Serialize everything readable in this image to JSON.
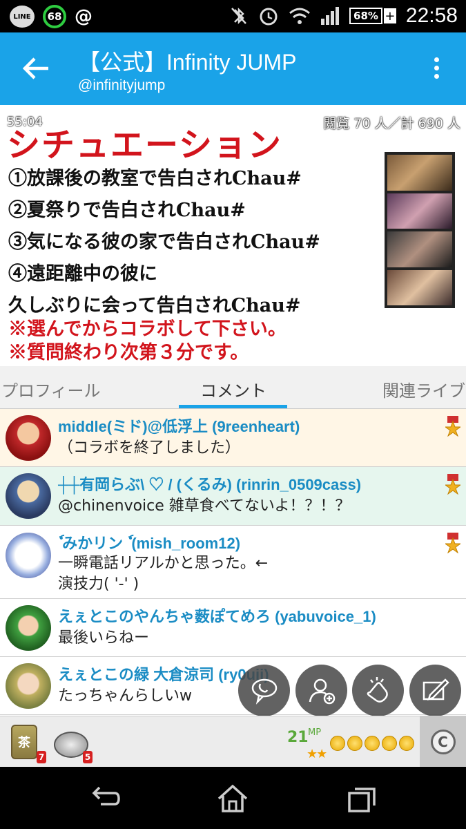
{
  "status_bar": {
    "line_label": "LINE",
    "notification_count": "68",
    "at_symbol": "@",
    "battery": "68%",
    "time": "22:58",
    "icons": [
      "bluetooth-off-icon",
      "alarm-icon",
      "wifi-icon",
      "signal-icon",
      "battery-icon"
    ]
  },
  "app_bar": {
    "title": "【公式】Infinity JUMP",
    "subtitle": "@infinityjump"
  },
  "broadcast": {
    "elapsed": "55:04",
    "viewers": "閲覧 70 人／計 690 人",
    "heading": "シチュエーション",
    "lines": [
      "①放課後の教室で告白されChau#",
      "②夏祭りで告白されChau#",
      "③気になる彼の家で告白されChau#",
      "④遠距離中の彼に",
      "久しぶりに会って告白されChau#"
    ],
    "notes": [
      "※選んでからコラボして下さい。",
      "※質問終わり次第３分です。"
    ]
  },
  "tabs": [
    {
      "label": "プロフィール",
      "active": false
    },
    {
      "label": "コメント",
      "active": true
    },
    {
      "label": "関連ライブ",
      "active": false
    }
  ],
  "comments": [
    {
      "name": "middle(ミド)@低浮上 (9reenheart)",
      "lines": [
        "（コラボを終了しました）"
      ],
      "bg": "#fff6e6",
      "medal": true
    },
    {
      "name": "┼┼有岡らぶ\\ ♡ / (くるみ) (rinrin_0509cass)",
      "lines": [
        "@chinenvoice 雑草食べてないよ！？！？"
      ],
      "bg": "#e6f6ee",
      "medal": true
    },
    {
      "name": "ٗ みかリン ٗ (mish_room12)",
      "lines": [
        "一瞬電話リアルかと思った。←",
        "演技力( '-' )"
      ],
      "bg": "#ffffff",
      "medal": true
    },
    {
      "name": "えぇとこのやんちゃ薮ぽてめろ (yabuvoice_1)",
      "lines": [
        "最後いらねー"
      ],
      "bg": "#ffffff",
      "medal": false
    },
    {
      "name": "えぇとこの緑 大倉涼司 (ry0uji)",
      "lines": [
        "たっちゃんらしいw"
      ],
      "bg": "#ffffff",
      "medal": false
    }
  ],
  "toolbar": {
    "tea_label": "茶",
    "tea_count": "7",
    "coin_item_count": "5",
    "mp_value": "21",
    "mp_label": "MP",
    "stars": "★★",
    "coin_count_shown": 5,
    "c_button_label": "C"
  },
  "colors": {
    "app_bar": "#1aa3e8",
    "name_text": "#1a8cc4",
    "broadcast_red": "#d2141c"
  }
}
